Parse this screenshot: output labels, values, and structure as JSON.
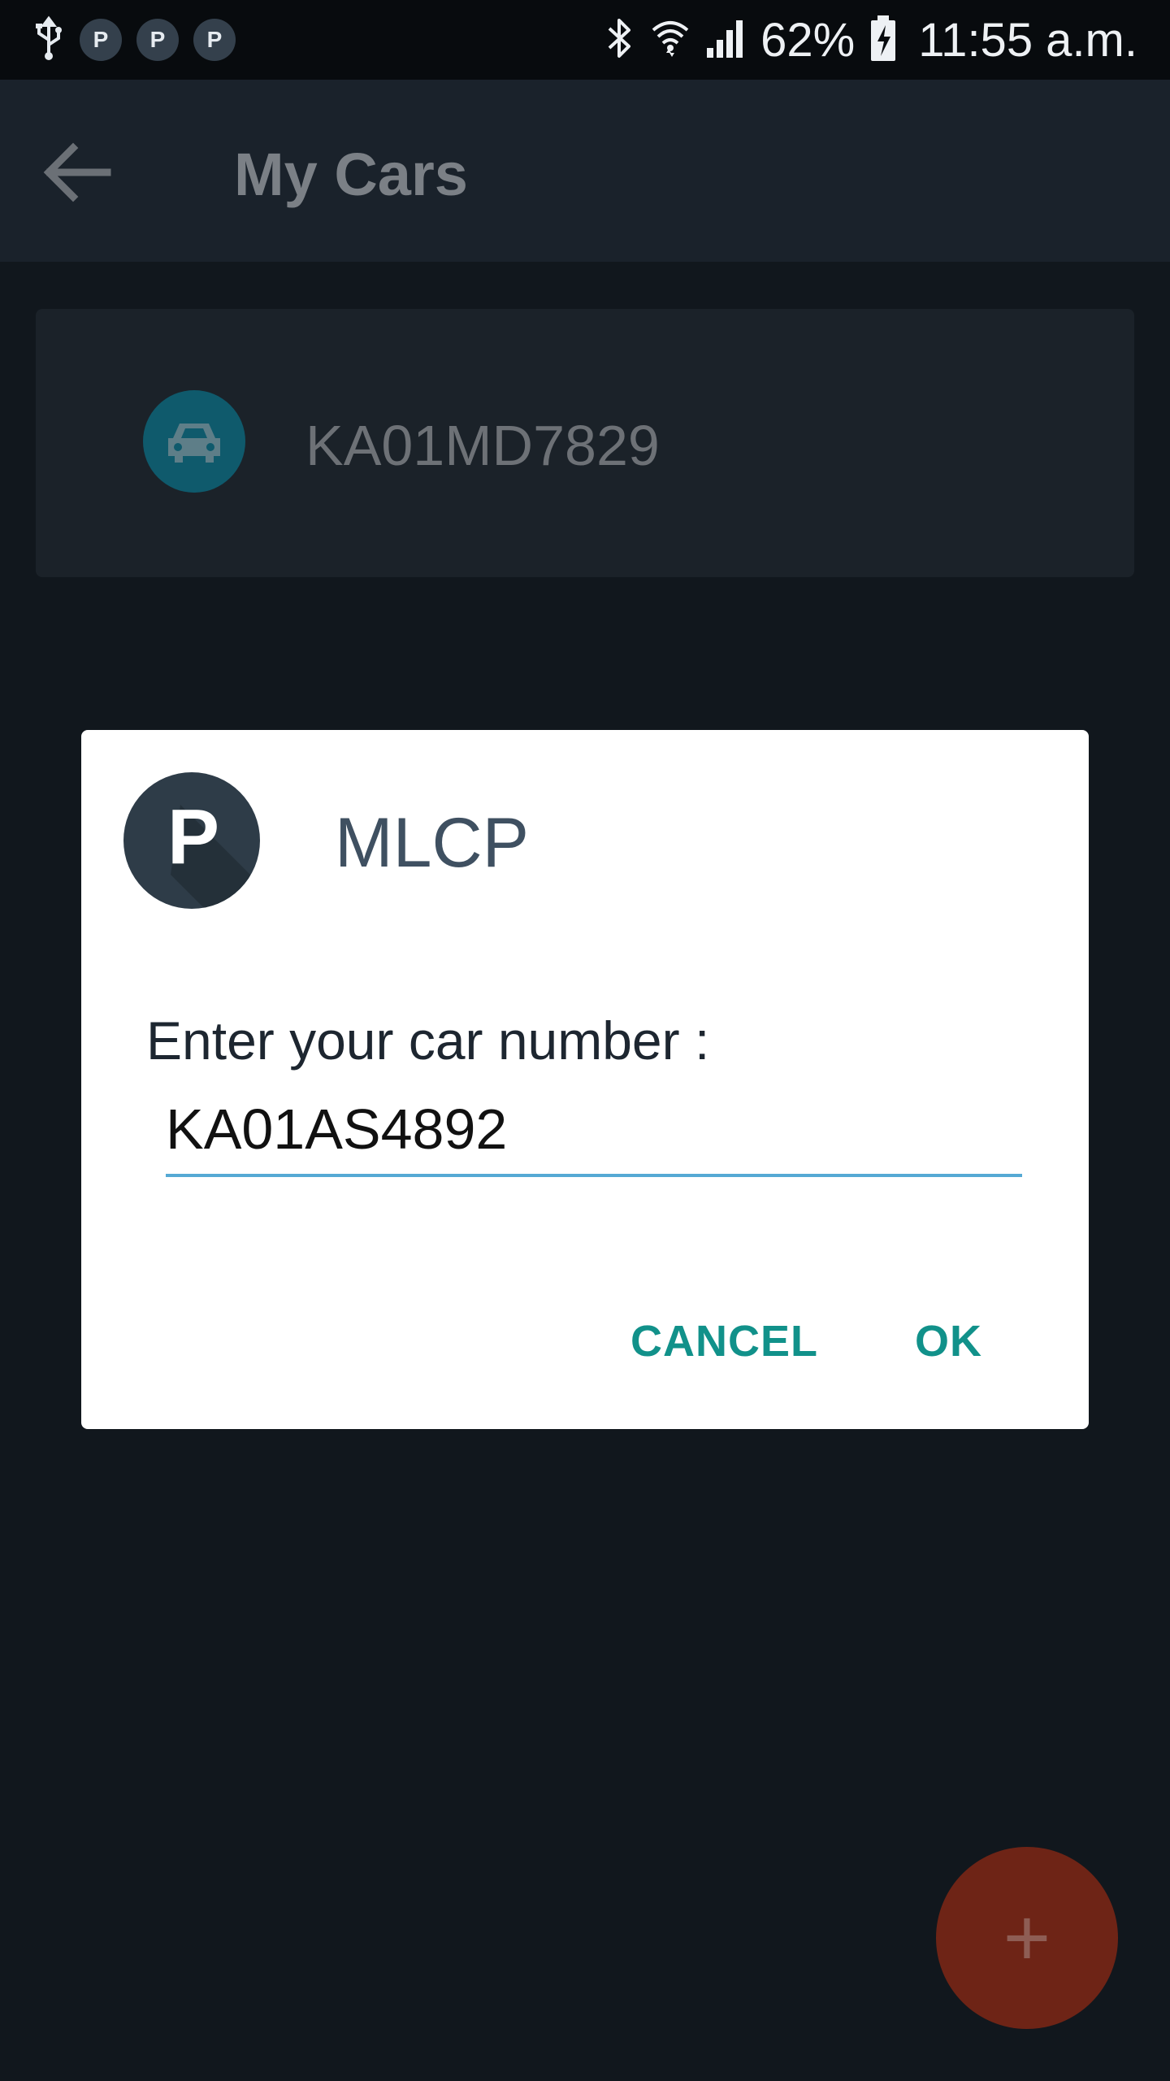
{
  "status_bar": {
    "left_icons": [
      "usb-icon",
      "parking-notification-icon",
      "parking-notification-icon",
      "parking-notification-icon"
    ],
    "notification_letter": "P",
    "right_icons": [
      "bluetooth-icon",
      "wifi-icon",
      "signal-icon",
      "battery-charging-icon"
    ],
    "battery": "62%",
    "time": "11:55 a.m."
  },
  "app_bar": {
    "title": "My Cars",
    "back_icon": "arrow-left-icon"
  },
  "cars": [
    {
      "plate": "KA01MD7829",
      "icon": "car-icon"
    }
  ],
  "fab": {
    "label": "+",
    "icon": "plus-icon",
    "color": "#6e2416"
  },
  "dialog": {
    "logo_letter": "P",
    "title": "MLCP",
    "label": "Enter your car number :",
    "input_value": "KA01AS4892",
    "cancel_label": "CANCEL",
    "ok_label": "OK",
    "accent": "#11918a",
    "underline": "#55a9d4"
  }
}
